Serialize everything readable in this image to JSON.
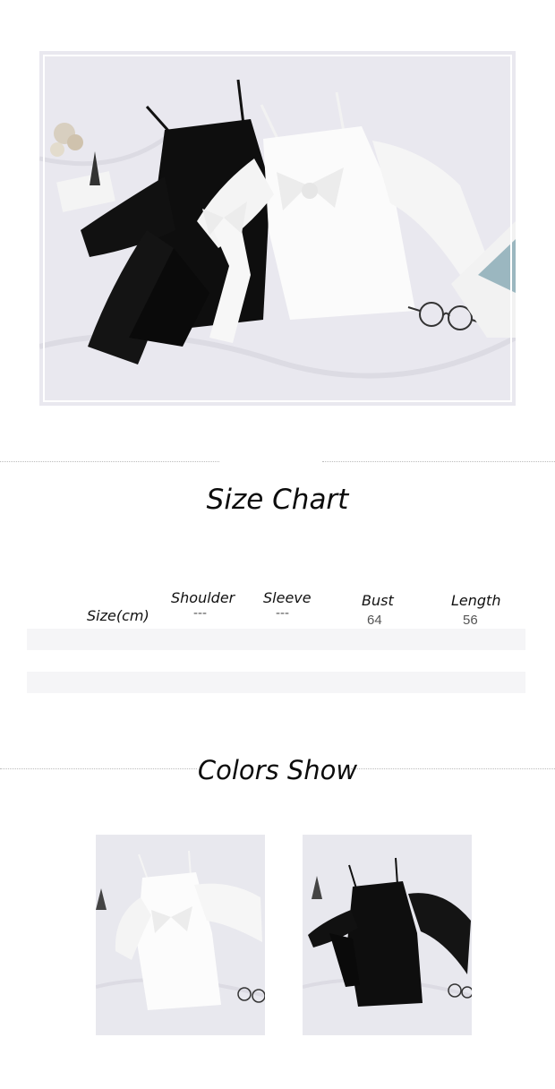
{
  "size_chart": {
    "title": "Size Chart",
    "row_label": "Size(cm)",
    "columns": [
      {
        "header": "Shoulder",
        "value": "---"
      },
      {
        "header": "Sleeve",
        "value": "---"
      },
      {
        "header": "Bust",
        "value": "64"
      },
      {
        "header": "Length",
        "value": "56"
      }
    ]
  },
  "colors_show": {
    "title": "Colors Show",
    "items": [
      {
        "name": "white",
        "color": "#ffffff"
      },
      {
        "name": "black",
        "color": "#0e0e0e"
      }
    ]
  },
  "hero": {
    "tablecloth_color": "#e9e8ef",
    "garments": [
      "black",
      "white"
    ]
  }
}
